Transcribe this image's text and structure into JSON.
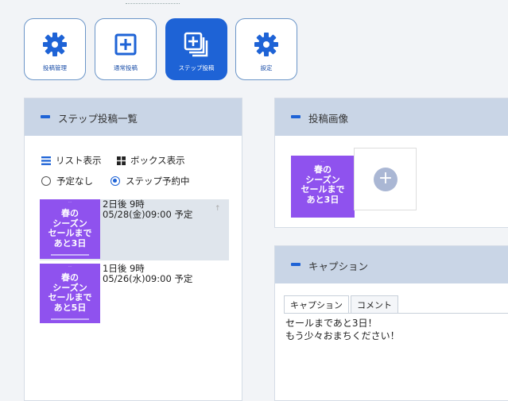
{
  "toolbar": {
    "items": [
      {
        "label": "投稿管理",
        "icon": "gear-icon",
        "active": false
      },
      {
        "label": "通常投稿",
        "icon": "plus-square-icon",
        "active": false
      },
      {
        "label": "ステップ投稿",
        "icon": "stacked-plus-icon",
        "active": true
      },
      {
        "label": "設定",
        "icon": "gear-icon",
        "active": false
      }
    ]
  },
  "step_list_panel": {
    "title": "ステップ投稿一覧",
    "view_modes": [
      "リスト表示",
      "ボックス表示"
    ],
    "filters": [
      {
        "label": "予定なし",
        "selected": false
      },
      {
        "label": "ステップ予約中",
        "selected": true
      }
    ],
    "items": [
      {
        "relative": "2日後 9時",
        "schedule": "05/28(金)09:00 予定",
        "thumb_text": "春の\nシーズン\nセールまで\nあと3日",
        "selected": true
      },
      {
        "relative": "1日後 9時",
        "schedule": "05/26(水)09:00 予定",
        "thumb_text": "春の\nシーズン\nセールまで\nあと5日",
        "selected": false
      }
    ]
  },
  "image_panel": {
    "title": "投稿画像",
    "thumb_text": "春の\nシーズン\nセールまで\nあと3日",
    "add_icon": "plus-circle-icon"
  },
  "caption_panel": {
    "title": "キャプション",
    "tabs": [
      "キャプション",
      "コメント"
    ],
    "text": "セールまであと3日！\nもう少々おまちください！"
  },
  "colors": {
    "accent": "#1e63d6",
    "header": "#c9d5e6",
    "thumb": "#8f52ee"
  }
}
